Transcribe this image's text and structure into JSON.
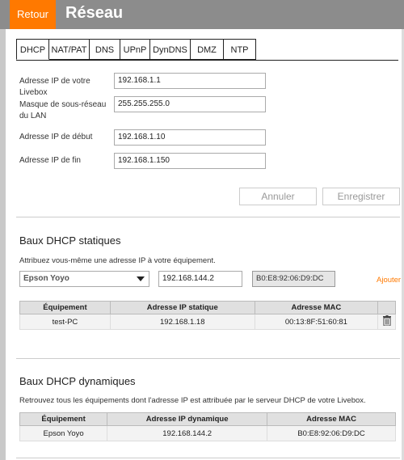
{
  "header": {
    "back_label": "Retour",
    "title": "Réseau"
  },
  "tabs": [
    {
      "label": "DHCP",
      "active": true
    },
    {
      "label": "NAT/PAT",
      "active": false
    },
    {
      "label": "DNS",
      "active": false
    },
    {
      "label": "UPnP",
      "active": false
    },
    {
      "label": "DynDNS",
      "active": false
    },
    {
      "label": "DMZ",
      "active": false
    },
    {
      "label": "NTP",
      "active": false
    }
  ],
  "dhcp_form": {
    "livebox_ip": {
      "label": "Adresse IP de votre Livebox",
      "value": "192.168.1.1"
    },
    "subnet_mask": {
      "label": "Masque de sous-réseau du LAN",
      "value": "255.255.255.0"
    },
    "start_ip": {
      "label": "Adresse IP de début",
      "value": "192.168.1.10"
    },
    "end_ip": {
      "label": "Adresse IP de fin",
      "value": "192.168.1.150"
    },
    "cancel_label": "Annuler",
    "save_label": "Enregistrer"
  },
  "static_leases": {
    "title": "Baux DHCP statiques",
    "description": "Attribuez vous-même une adresse IP à votre équipement.",
    "device_select": "Epson Yoyo",
    "ip_input": "192.168.144.2",
    "mac_display": "B0:E8:92:06:D9:DC",
    "add_label": "Ajouter",
    "columns": [
      "Équipement",
      "Adresse IP statique",
      "Adresse MAC"
    ],
    "rows": [
      {
        "device": "test-PC",
        "ip": "192.168.1.18",
        "mac": "00:13:8F:51:60:81"
      }
    ]
  },
  "dynamic_leases": {
    "title": "Baux DHCP dynamiques",
    "description": "Retrouvez tous les équipements dont l'adresse IP est attribuée par le serveur DHCP de votre Livebox.",
    "columns": [
      "Équipement",
      "Adresse IP dynamique",
      "Adresse MAC"
    ],
    "rows": [
      {
        "device": "Epson Yoyo",
        "ip": "192.168.144.2",
        "mac": "B0:E8:92:06:D9:DC"
      }
    ]
  },
  "colors": {
    "accent": "#ff7900",
    "header_bg": "#8c8c8c"
  }
}
